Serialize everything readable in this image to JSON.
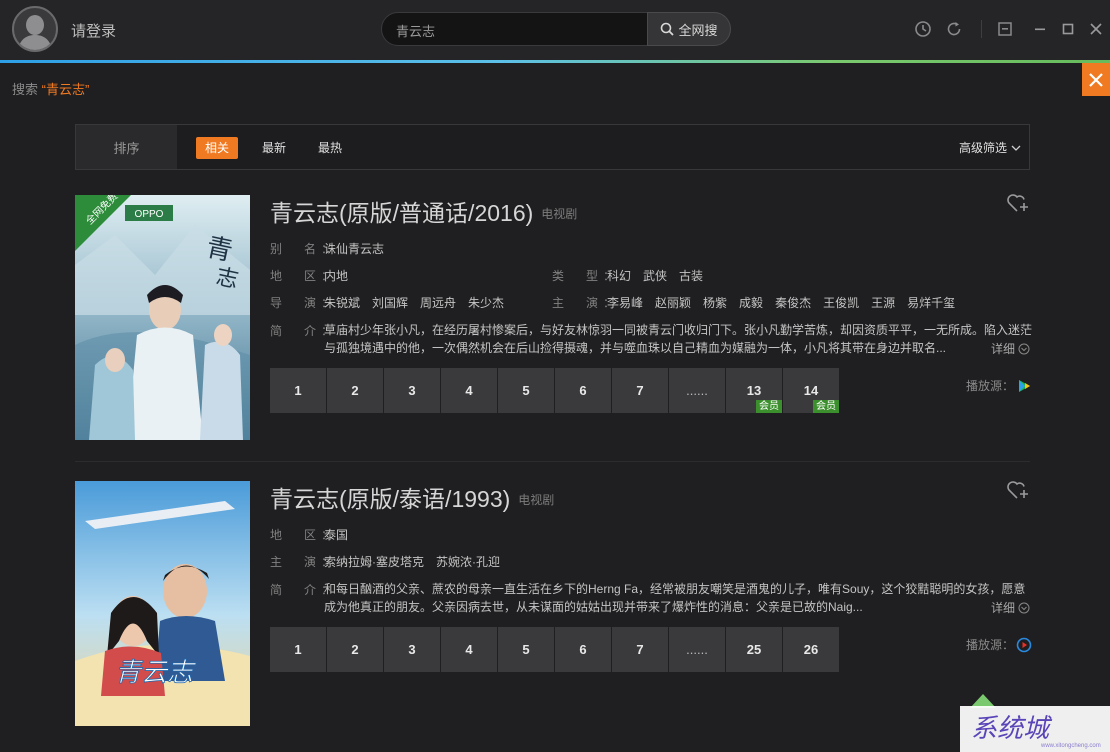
{
  "header": {
    "login_label": "请登录",
    "search_value": "青云志",
    "search_button_label": "全网搜"
  },
  "breadcrumb": {
    "prefix": "搜索",
    "keyword": "“青云志”"
  },
  "sortbar": {
    "label": "排序",
    "options": [
      "相关",
      "最新",
      "最热"
    ],
    "active_option": "相关",
    "advanced_filter_label": "高级筛选"
  },
  "results": [
    {
      "title": "青云志(原版/普通话/2016)",
      "type": "电视剧",
      "poster_badge": "全网免费",
      "poster_brand": "OPPO",
      "fields": {
        "alias_label": "别　名：",
        "alias": "诛仙青云志",
        "region_label": "地　区：",
        "region": "内地",
        "genre_label": "类　型：",
        "genres": [
          "科幻",
          "武侠",
          "古装"
        ],
        "director_label": "导　演：",
        "directors": [
          "朱锐斌",
          "刘国辉",
          "周远舟",
          "朱少杰"
        ],
        "cast_label": "主　演：",
        "cast": [
          "李易峰",
          "赵丽颖",
          "杨紫",
          "成毅",
          "秦俊杰",
          "王俊凯",
          "王源",
          "易烊千玺"
        ],
        "desc_label": "简　介：",
        "desc": "草庙村少年张小凡，在经历屠村惨案后，与好友林惊羽一同被青云门收归门下。张小凡勤学苦炼，却因资质平平，一无所成。陷入迷茫与孤独境遇中的他，一次偶然机会在后山捡得摄魂，并与噬血珠以自己精血为媒融为一体，小凡将其带在身边并取名..."
      },
      "more_label": "详细",
      "episodes": [
        {
          "label": "1"
        },
        {
          "label": "2"
        },
        {
          "label": "3"
        },
        {
          "label": "4"
        },
        {
          "label": "5"
        },
        {
          "label": "6"
        },
        {
          "label": "7"
        },
        {
          "label": "......"
        },
        {
          "label": "13",
          "vip": "会员"
        },
        {
          "label": "14",
          "vip": "会员"
        }
      ],
      "source_label": "播放源："
    },
    {
      "title": "青云志(原版/泰语/1993)",
      "type": "电视剧",
      "poster_caption": "青云志",
      "fields": {
        "region_label": "地　区：",
        "region": "泰国",
        "cast_label": "主　演：",
        "cast": [
          "索纳拉姆·塞皮塔克",
          "苏婉浓·孔迎"
        ],
        "desc_label": "简　介：",
        "desc": "和每日酗酒的父亲、蔗农的母亲一直生活在乡下的Herng Fa，经常被朋友嘲笑是酒鬼的儿子，唯有Souy，这个狡黠聪明的女孩，愿意成为他真正的朋友。父亲因病去世，从未谋面的姑姑出现并带来了爆炸性的消息：父亲是已故的Naig..."
      },
      "more_label": "详细",
      "episodes": [
        {
          "label": "1"
        },
        {
          "label": "2"
        },
        {
          "label": "3"
        },
        {
          "label": "4"
        },
        {
          "label": "5"
        },
        {
          "label": "6"
        },
        {
          "label": "7"
        },
        {
          "label": "......"
        },
        {
          "label": "25"
        },
        {
          "label": "26"
        }
      ],
      "source_label": "播放源："
    }
  ],
  "watermark": {
    "text": "系统城",
    "sub": "www.xitongcheng.com"
  },
  "colors": {
    "accent_orange": "#f07a22",
    "vip_green": "#3b8f2c",
    "background": "#1f1f21"
  }
}
